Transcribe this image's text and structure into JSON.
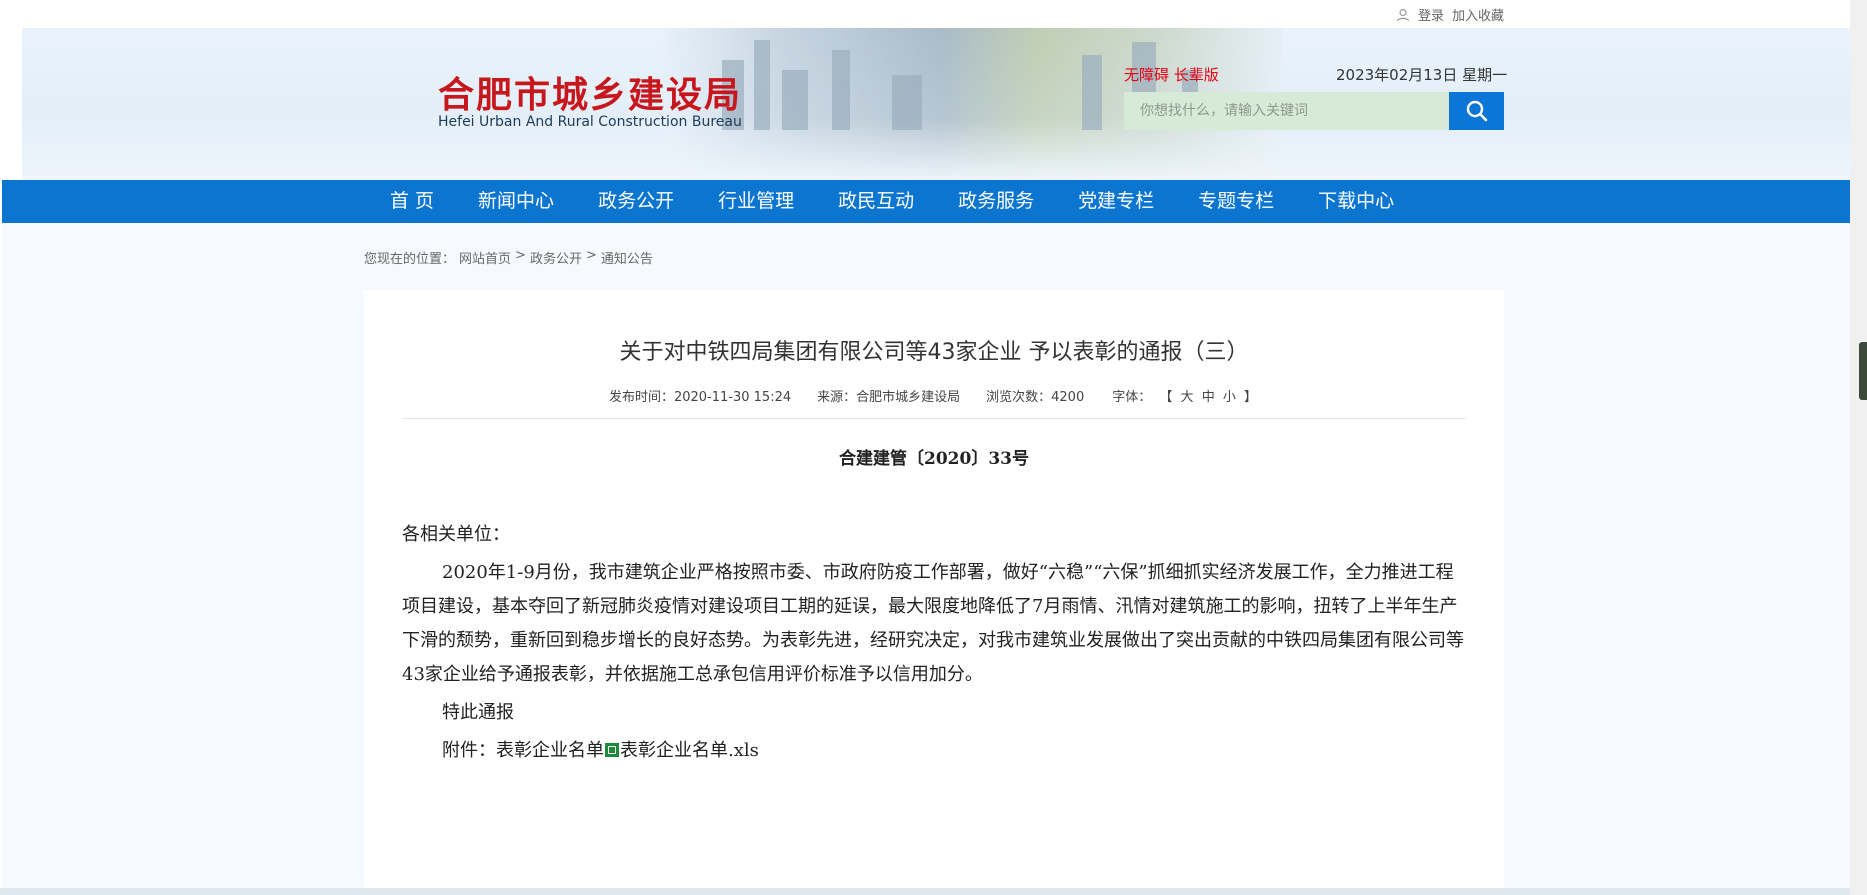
{
  "topbar": {
    "login_label": "登录",
    "favorite_label": "加入收藏"
  },
  "header": {
    "logo_cn": "合肥市城乡建设局",
    "logo_en": "Hefei Urban And Rural Construction Bureau",
    "accessibility_label": "无障碍 长辈版",
    "date_text": "2023年02月13日 星期一",
    "search_placeholder": "你想找什么，请输入关键词"
  },
  "nav": {
    "items": [
      {
        "label": "首 页"
      },
      {
        "label": "新闻中心"
      },
      {
        "label": "政务公开"
      },
      {
        "label": "行业管理"
      },
      {
        "label": "政民互动"
      },
      {
        "label": "政务服务"
      },
      {
        "label": "党建专栏"
      },
      {
        "label": "专题专栏"
      },
      {
        "label": "下载中心"
      }
    ]
  },
  "breadcrumb": {
    "prefix": "您现在的位置：",
    "home": "网站首页",
    "sep1": ">",
    "level1": "政务公开",
    "sep2": ">",
    "level2": "通知公告"
  },
  "article": {
    "title": "关于对中铁四局集团有限公司等43家企业 予以表彰的通报（三）",
    "publish_time": "发布时间：2020-11-30 15:24",
    "source": "来源：合肥市城乡建设局",
    "views": "浏览次数：4200",
    "font_label": "字体：",
    "font_open": "【",
    "font_large": "大",
    "font_medium": "中",
    "font_small": "小",
    "font_close": "】",
    "doc_number": "合建建管〔2020〕33号",
    "salutation": "各相关单位：",
    "paragraph": "2020年1-9月份，我市建筑企业严格按照市委、市政府防疫工作部署，做好“六稳”“六保”抓细抓实经济发展工作，全力推进工程项目建设，基本夺回了新冠肺炎疫情对建设项目工期的延误，最大限度地降低了7月雨情、汛情对建筑施工的影响，扭转了上半年生产下滑的颓势，重新回到稳步增长的良好态势。为表彰先进，经研究决定，对我市建筑业发展做出了突出贡献的中铁四局集团有限公司等43家企业给予通报表彰，并依据施工总承包信用评价标准予以信用加分。",
    "closing": "特此通报",
    "attachment_label": "附件：表彰企业名单",
    "attachment_file": "表彰企业名单.xls"
  },
  "colors": {
    "nav_blue": "#0b75d0",
    "logo_red": "#c8161d",
    "search_bg": "#d7ead8",
    "search_button": "#0b76d6"
  }
}
